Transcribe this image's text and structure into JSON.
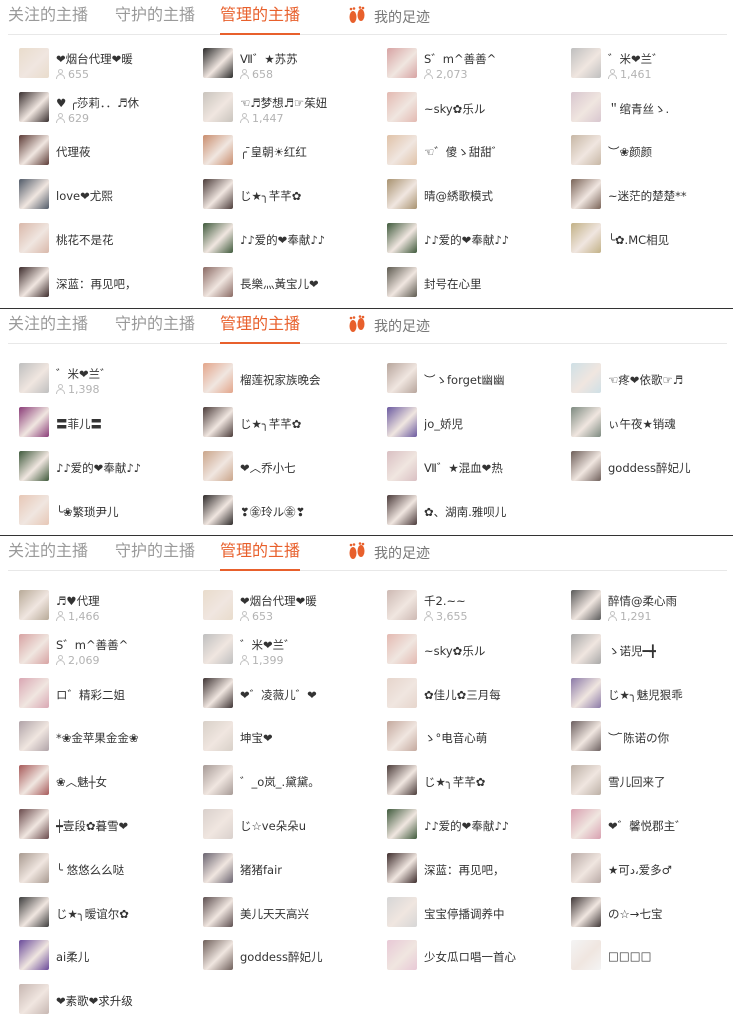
{
  "tabs": {
    "follow": "关注的主播",
    "guard_prefix": "守护的主播",
    "manage_prefix": "管理",
    "manage_suffix": "的主播",
    "footprint": "我的足迹",
    "accent_color": "#e8602c",
    "footprint_icon": "footprint-icon"
  },
  "panels": [
    {
      "users": [
        {
          "name": "❤烟台代理❤暖",
          "fans": "655",
          "avatar": "#e9dccc"
        },
        {
          "name": "Ⅶ゛★苏苏",
          "fans": "658",
          "avatar": "#2b2b2b"
        },
        {
          "name": "S゛m^善善^",
          "fans": "2,073",
          "avatar": "#d7a3a3"
        },
        {
          "name": "゛米❤兰゛",
          "fans": "1,461",
          "avatar": "#bfbfbf"
        },
        {
          "name": "♥ ╭莎莉．．♬休",
          "fans": "629",
          "avatar": "#3a3030"
        },
        {
          "name": "☜♬梦想♬☞茱妞",
          "fans": "1,447",
          "avatar": "#c9c4bd"
        },
        {
          "name": "~sky✿乐ル",
          "fans": "",
          "avatar": "#e3b9b1"
        },
        {
          "name": "＂绾青丝ゝ.",
          "fans": "",
          "avatar": "#d8c6cf"
        },
        {
          "name": "代理莜",
          "fans": "",
          "avatar": "#5c3b36"
        },
        {
          "name": "╭ ̄皇朝☀红红",
          "fans": "",
          "avatar": "#c98d6e"
        },
        {
          "name": "☜゛傻ゝ甜甜゛",
          "fans": "",
          "avatar": "#e0c2a8"
        },
        {
          "name": "︶❀颜颜",
          "fans": "",
          "avatar": "#c7b7a5"
        },
        {
          "name": "love❤尤熙",
          "fans": "",
          "avatar": "#505a68"
        },
        {
          "name": "じ★╮芊芊✿",
          "fans": "",
          "avatar": "#4b3c3a"
        },
        {
          "name": "晴@綉歌模式",
          "fans": "",
          "avatar": "#a89270"
        },
        {
          "name": "~迷茫的楚楚**",
          "fans": "",
          "avatar": "#7a6458"
        },
        {
          "name": "桃花不是花",
          "fans": "",
          "avatar": "#d9b8aa"
        },
        {
          "name": "♪♪爱的❤奉献♪♪",
          "fans": "",
          "avatar": "#3f5a3c"
        },
        {
          "name": "♪♪爱的❤奉献♪♪",
          "fans": "",
          "avatar": "#3f5a3c"
        },
        {
          "name": "╰✿.MC相见",
          "fans": "",
          "avatar": "#c2b186"
        },
        {
          "name": "深蓝：再见吧，",
          "fans": "",
          "avatar": "#3d2c2c"
        },
        {
          "name": "長樂灬黃宝儿❤",
          "fans": "",
          "avatar": "#8a6a64"
        },
        {
          "name": "封号在心里",
          "fans": "",
          "avatar": "#5d5a50"
        }
      ]
    },
    {
      "users": [
        {
          "name": "゛米❤兰゛",
          "fans": "1,398",
          "avatar": "#bfbfbf"
        },
        {
          "name": "榴莲祝家族晚会",
          "fans": "",
          "avatar": "#e3a58a"
        },
        {
          "name": "︶ゝforget幽幽",
          "fans": "",
          "avatar": "#b7a59c"
        },
        {
          "name": "☜疼❤依歌☞♬",
          "fans": "",
          "avatar": "#cfe0e6"
        },
        {
          "name": "〓菲儿〓",
          "fans": "",
          "avatar": "#8a3c78"
        },
        {
          "name": "じ★╮芊芊✿",
          "fans": "",
          "avatar": "#4b3c3a"
        },
        {
          "name": "jo_娇児",
          "fans": "",
          "avatar": "#6b5aa0"
        },
        {
          "name": "ぃ午夜★销魂",
          "fans": "",
          "avatar": "#7d8a80"
        },
        {
          "name": "♪♪爱的❤奉献♪♪",
          "fans": "",
          "avatar": "#3f5a3c"
        },
        {
          "name": "❤︿乔小七",
          "fans": "",
          "avatar": "#caa58a"
        },
        {
          "name": "Ⅶ゛★混血❤热",
          "fans": "",
          "avatar": "#d9bfc2"
        },
        {
          "name": "goddess醉妃儿",
          "fans": "",
          "avatar": "#6e5f5a"
        },
        {
          "name": "╰❀繁琐尹儿",
          "fans": "",
          "avatar": "#e7c7b6"
        },
        {
          "name": "❣㊎玲ル㊎❣",
          "fans": "",
          "avatar": "#2e2a2a"
        },
        {
          "name": "✿、湖南.雅呗儿",
          "fans": "",
          "avatar": "#4a3a3a"
        }
      ]
    },
    {
      "users": [
        {
          "name": "♬♥代理",
          "fans": "1,466",
          "avatar": "#b8aa98"
        },
        {
          "name": "❤烟台代理❤暖",
          "fans": "653",
          "avatar": "#e9dccc"
        },
        {
          "name": "千2.~~",
          "fans": "3,655",
          "avatar": "#cdb9b3"
        },
        {
          "name": "醉情@柔心雨",
          "fans": "1,291",
          "avatar": "#5a5a5a"
        },
        {
          "name": "S゛m^善善^",
          "fans": "2,069",
          "avatar": "#d7a3a3"
        },
        {
          "name": "゛米❤兰゛",
          "fans": "1,399",
          "avatar": "#bfbfbf"
        },
        {
          "name": "~sky✿乐ル",
          "fans": "",
          "avatar": "#e3b9b1"
        },
        {
          "name": "ゝ诺児━╋",
          "fans": "",
          "avatar": "#a8a8a8"
        },
        {
          "name": "ロ゛精彩二姐",
          "fans": "",
          "avatar": "#d9a7b3"
        },
        {
          "name": "❤゛凌薇儿゛❤",
          "fans": "",
          "avatar": "#3e3434"
        },
        {
          "name": "✿佳儿✿三月每",
          "fans": "",
          "avatar": "#e6d5cc"
        },
        {
          "name": "じ★╮魅児狠乖",
          "fans": "",
          "avatar": "#8b7aa8"
        },
        {
          "name": "*❀金苹果金金❀",
          "fans": "",
          "avatar": "#b0a3a8"
        },
        {
          "name": "坤宝❤",
          "fans": "",
          "avatar": "#d8d0c8"
        },
        {
          "name": "ゝ°电音心萌",
          "fans": "",
          "avatar": "#c4a99e"
        },
        {
          "name": "︶ ̄陈诺の你",
          "fans": "",
          "avatar": "#6c6060"
        },
        {
          "name": "❀︿魅┼女",
          "fans": "",
          "avatar": "#a75a5a"
        },
        {
          "name": "゛_o岚_.黛黛。",
          "fans": "",
          "avatar": "#a69a96"
        },
        {
          "name": "じ★╮芊芊✿",
          "fans": "",
          "avatar": "#4b3c3a"
        },
        {
          "name": "雪儿回来了",
          "fans": "",
          "avatar": "#bcb0a6"
        },
        {
          "name": "┿壹段✿暮雪❤",
          "fans": "",
          "avatar": "#6a4a4c"
        },
        {
          "name": "じ☆ve朵朵u",
          "fans": "",
          "avatar": "#d9d0cc"
        },
        {
          "name": "♪♪爱的❤奉献♪♪",
          "fans": "",
          "avatar": "#3f5a3c"
        },
        {
          "name": "❤゛馨悦郡主゛",
          "fans": "",
          "avatar": "#d8a0b0"
        },
        {
          "name": "╰ 悠悠么么哒",
          "fans": "",
          "avatar": "#a89a90"
        },
        {
          "name": "猪猪fair",
          "fans": "",
          "avatar": "#6a6470"
        },
        {
          "name": "深蓝：再见吧，",
          "fans": "",
          "avatar": "#3d2c2c"
        },
        {
          "name": "★可د،爱多♂",
          "fans": "",
          "avatar": "#b9aaa6"
        },
        {
          "name": "じ★╮暧谊尔✿",
          "fans": "",
          "avatar": "#3d3d3d"
        },
        {
          "name": "美儿天天高兴",
          "fans": "",
          "avatar": "#5d4f50"
        },
        {
          "name": "宝宝停播调养中",
          "fans": "",
          "avatar": "#d6d6d6"
        },
        {
          "name": "の☆→七宝",
          "fans": "",
          "avatar": "#403838"
        },
        {
          "name": "ai柔儿",
          "fans": "",
          "avatar": "#6a4a9a"
        },
        {
          "name": "goddess醉妃儿",
          "fans": "",
          "avatar": "#6e5f5a"
        },
        {
          "name": "少女瓜ロ唱一首心",
          "fans": "",
          "avatar": "#e8c8d6"
        },
        {
          "name": "□□□□",
          "fans": "",
          "avatar": "#f4f4f4"
        },
        {
          "name": "❤素歌❤求升级",
          "fans": "",
          "avatar": "#c7b7b2"
        }
      ]
    }
  ]
}
